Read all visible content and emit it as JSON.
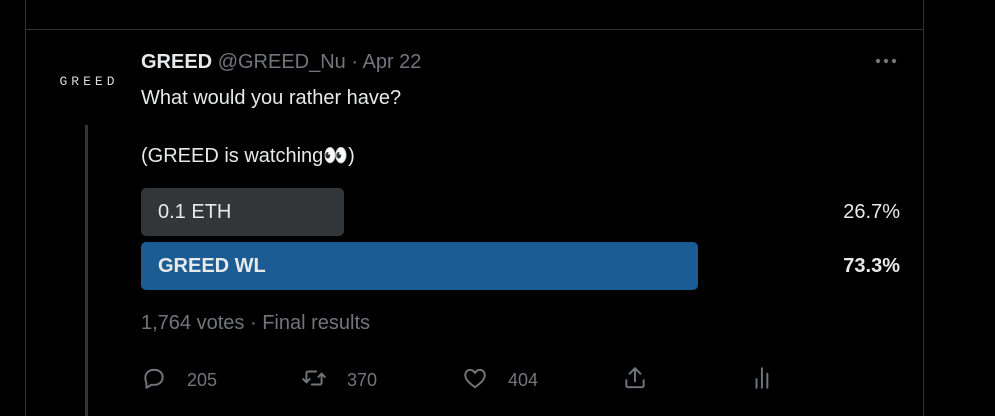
{
  "tweet": {
    "avatar_text": "GREED",
    "display_name": "GREED",
    "handle": "@GREED_Nu",
    "separator": "·",
    "date": "Apr 22",
    "text_line1": "What would you rather have?",
    "text_line2": "(GREED is watching👀)"
  },
  "poll": {
    "options": [
      {
        "label": "0.1 ETH",
        "percent_text": "26.7%",
        "percent": 26.7,
        "winner": false
      },
      {
        "label": "GREED WL",
        "percent_text": "73.3%",
        "percent": 73.3,
        "winner": true
      }
    ],
    "votes": "1,764 votes",
    "status": "Final results",
    "meta_separator": "·"
  },
  "actions": {
    "replies": "205",
    "retweets": "370",
    "likes": "404"
  },
  "icons": [
    "more-icon",
    "reply-icon",
    "retweet-icon",
    "like-icon",
    "share-icon",
    "analytics-icon"
  ],
  "colors": {
    "background": "#000000",
    "winner_bar": "#1a5c93",
    "loser_bar": "#333639",
    "muted_text": "#71767b",
    "primary_text": "#e7e9ea"
  }
}
